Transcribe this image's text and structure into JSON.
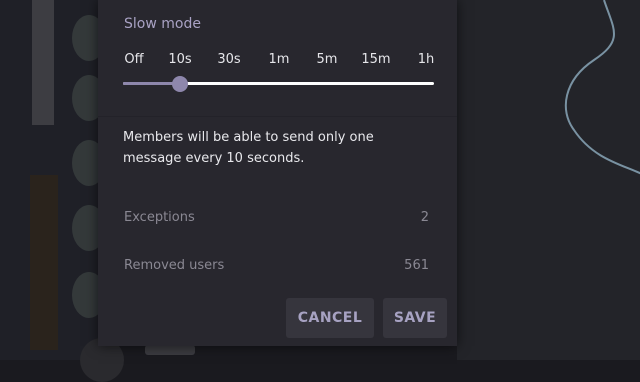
{
  "slow_mode": {
    "title": "Slow mode",
    "options": [
      "Off",
      "10s",
      "30s",
      "1m",
      "5m",
      "15m",
      "1h"
    ],
    "selected": "10s",
    "description": "Members will be able to send only one message every 10 seconds."
  },
  "rows": [
    {
      "label": "Exceptions",
      "value": "2"
    },
    {
      "label": "Removed users",
      "value": "561"
    }
  ],
  "buttons": {
    "cancel": "CANCEL",
    "save": "SAVE"
  },
  "colors": {
    "accent": "#8e87ac",
    "dialog_bg": "#28272e",
    "button_bg": "#36353d"
  }
}
